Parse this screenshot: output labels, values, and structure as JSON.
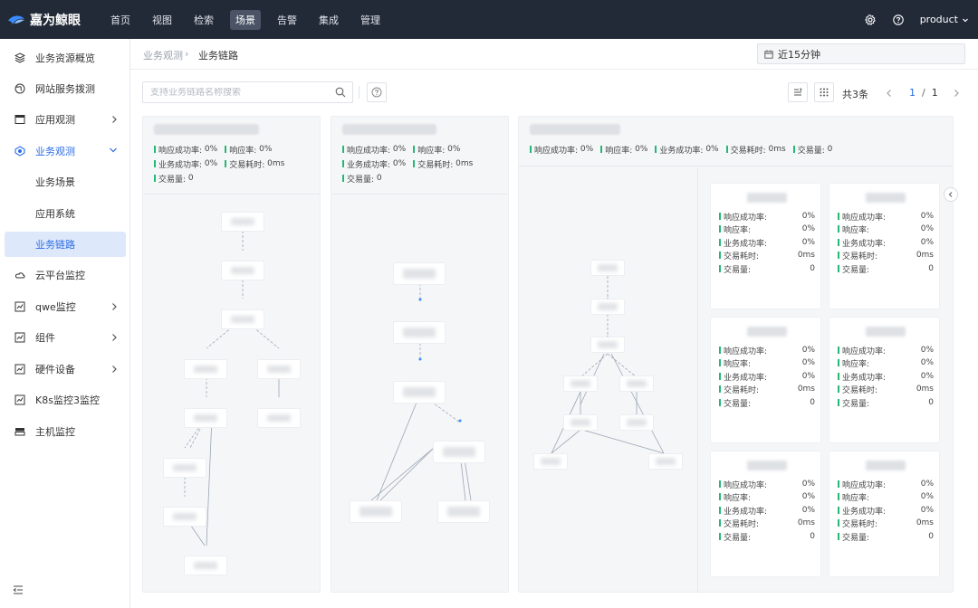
{
  "brand": {
    "name": "嘉为鲸眼"
  },
  "topnav": [
    {
      "label": "首页",
      "active": false
    },
    {
      "label": "视图",
      "active": false
    },
    {
      "label": "检索",
      "active": false
    },
    {
      "label": "场景",
      "active": true
    },
    {
      "label": "告警",
      "active": false
    },
    {
      "label": "集成",
      "active": false
    },
    {
      "label": "管理",
      "active": false
    }
  ],
  "user": {
    "name": "product"
  },
  "sidebar": [
    {
      "label": "业务资源概览",
      "icon": "layers-icon",
      "chevron": false
    },
    {
      "label": "网站服务拨测",
      "icon": "globe-icon",
      "chevron": false
    },
    {
      "label": "应用观测",
      "icon": "app-window-icon",
      "chevron": true
    },
    {
      "label": "业务观测",
      "icon": "target-icon",
      "chevron": true,
      "expanded": true
    },
    {
      "label": "业务场景",
      "sub": true
    },
    {
      "label": "应用系统",
      "sub": true
    },
    {
      "label": "业务链路",
      "sub": true,
      "selected": true
    },
    {
      "label": "云平台监控",
      "icon": "cloud-icon",
      "chevron": false
    },
    {
      "label": "qwe监控",
      "icon": "chart-icon",
      "chevron": true
    },
    {
      "label": "组件",
      "icon": "chart-icon",
      "chevron": true
    },
    {
      "label": "硬件设备",
      "icon": "chart-icon",
      "chevron": true
    },
    {
      "label": "K8s监控3监控",
      "icon": "chart-icon",
      "chevron": false
    },
    {
      "label": "主机监控",
      "icon": "server-icon",
      "chevron": false
    }
  ],
  "breadcrumb": {
    "parent": "业务观测",
    "current": "业务链路"
  },
  "time_range": {
    "value": "近15分钟"
  },
  "search": {
    "placeholder": "支持业务链路名称搜索"
  },
  "pagination": {
    "total_text": "共3条",
    "current": "1",
    "separator": "/",
    "pages": "1"
  },
  "labels": {
    "resp_success": "响应成功率:",
    "resp": "响应率:",
    "biz_success": "业务成功率:",
    "latency": "交易耗时:",
    "volume": "交易量:"
  },
  "panel_metrics": {
    "resp_success": "0%",
    "resp": "0%",
    "biz_success": "0%",
    "latency": "0ms",
    "volume": "0"
  },
  "cards": [
    {
      "resp_success": "0%",
      "resp": "0%",
      "biz_success": "0%",
      "latency": "0ms",
      "volume": "0"
    },
    {
      "resp_success": "0%",
      "resp": "0%",
      "biz_success": "0%",
      "latency": "0ms",
      "volume": "0"
    },
    {
      "resp_success": "0%",
      "resp": "0%",
      "biz_success": "0%",
      "latency": "0ms",
      "volume": "0"
    },
    {
      "resp_success": "0%",
      "resp": "0%",
      "biz_success": "0%",
      "latency": "0ms",
      "volume": "0"
    },
    {
      "resp_success": "0%",
      "resp": "0%",
      "biz_success": "0%",
      "latency": "0ms",
      "volume": "0"
    },
    {
      "resp_success": "0%",
      "resp": "0%",
      "biz_success": "0%",
      "latency": "0ms",
      "volume": "0"
    }
  ],
  "colors": {
    "topbar": "#222a38",
    "accent": "#2b6de5",
    "metric_bar": "#24b874"
  }
}
